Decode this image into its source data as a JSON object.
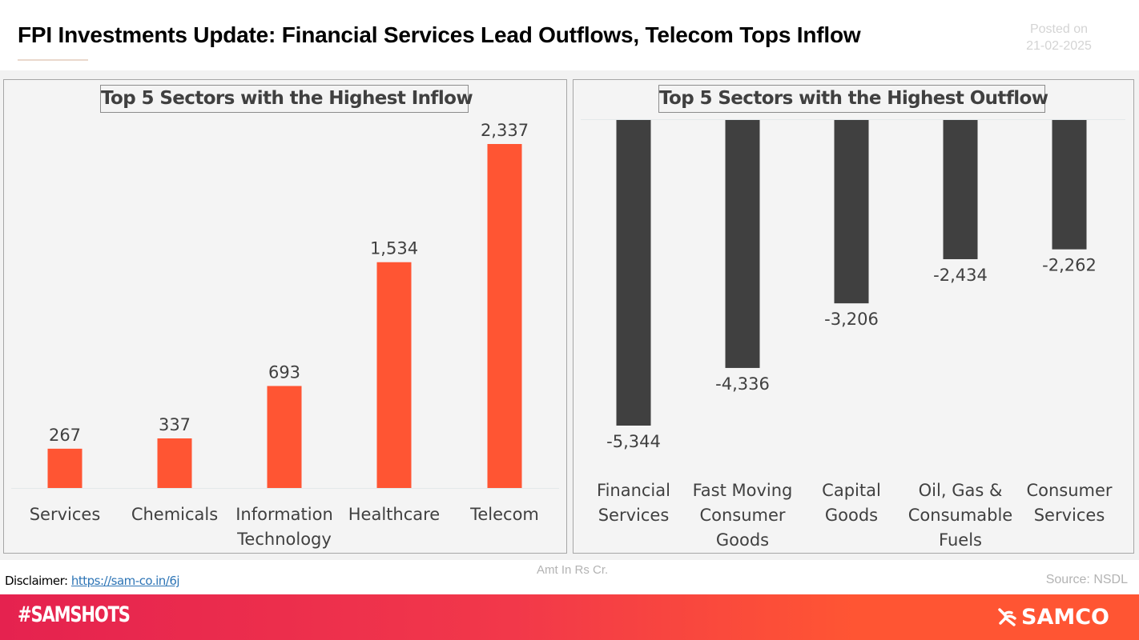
{
  "header": {
    "title": "FPI Investments Update: Financial Services Lead Outflows, Telecom Tops Inflow",
    "posted_label": "Posted on",
    "posted_date": "21-02-2025"
  },
  "colors": {
    "inflow_bar": "#ff5533",
    "outflow_bar": "#404040",
    "footer_start": "#e5224f",
    "footer_end": "#ff5533",
    "link": "#2e75b6"
  },
  "chart_data": [
    {
      "type": "bar",
      "title": "Top 5 Sectors with the Highest Inflow",
      "categories": [
        "Services",
        "Chemicals",
        "Information Technology",
        "Healthcare",
        "Telecom"
      ],
      "category_lines": [
        [
          "Services"
        ],
        [
          "Chemicals"
        ],
        [
          "Information",
          "Technology"
        ],
        [
          "Healthcare"
        ],
        [
          "Telecom"
        ]
      ],
      "values": [
        267,
        337,
        693,
        1534,
        2337
      ],
      "value_labels": [
        "267",
        "337",
        "693",
        "1,534",
        "2,337"
      ],
      "xlabel": "",
      "ylabel": "",
      "ylim": [
        0,
        2337
      ],
      "grid": false,
      "legend": "none"
    },
    {
      "type": "bar",
      "title": "Top 5 Sectors with the Highest Outflow",
      "categories": [
        "Financial Services",
        "Fast Moving Consumer Goods",
        "Capital Goods",
        "Oil, Gas & Consumable Fuels",
        "Consumer Services"
      ],
      "category_lines": [
        [
          "Financial",
          "Services"
        ],
        [
          "Fast Moving",
          "Consumer",
          "Goods"
        ],
        [
          "Capital",
          "Goods"
        ],
        [
          "Oil, Gas &",
          "Consumable",
          "Fuels"
        ],
        [
          "Consumer",
          "Services"
        ]
      ],
      "values": [
        -5344,
        -4336,
        -3206,
        -2434,
        -2262
      ],
      "value_labels": [
        "-5,344",
        "-4,336",
        "-3,206",
        "-2,434",
        "-2,262"
      ],
      "xlabel": "",
      "ylabel": "",
      "ylim": [
        -5344,
        0
      ],
      "grid": false,
      "legend": "none"
    }
  ],
  "notes": {
    "amount_unit": "Amt In Rs Cr.",
    "disclaimer_label": "Disclaimer:",
    "disclaimer_link": "https://sam-co.in/6j",
    "source": "Source: NSDL"
  },
  "footer": {
    "hashtag": "#SAMSHOTS",
    "brand": "SAMCO",
    "brand_icon": "samco-swirl-icon"
  }
}
